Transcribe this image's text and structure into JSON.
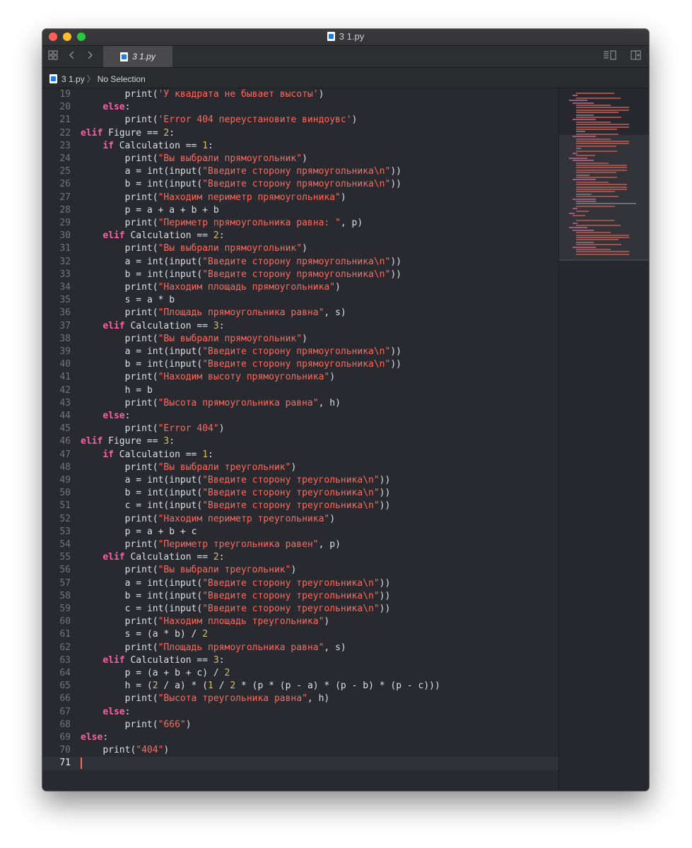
{
  "window": {
    "title": "3 1.py"
  },
  "tabs": [
    {
      "label": "3 1.py",
      "active": true
    }
  ],
  "jumpbar": {
    "file": "3 1.py",
    "selection": "No Selection"
  },
  "icons": {
    "grid": "related-items-grid-icon",
    "back": "chevron-left-icon",
    "forward": "chevron-right-icon",
    "editor_options": "editor-options-icon",
    "add_editor": "add-editor-icon"
  },
  "colors": {
    "background": "#292a30",
    "keyword": "#fc5fa3",
    "string": "#fc6a5d",
    "number": "#d0bf69",
    "text": "#dfdfe0",
    "line_number": "#747478"
  },
  "editor": {
    "current_line": 71,
    "lines": [
      {
        "n": 19,
        "code": "        print('У квадрата не бывает высоты')"
      },
      {
        "n": 20,
        "code": "    else:"
      },
      {
        "n": 21,
        "code": "        print('Error 404 переустановите виндоувс')"
      },
      {
        "n": 22,
        "code": "elif Figure == 2:"
      },
      {
        "n": 23,
        "code": "    if Calculation == 1:"
      },
      {
        "n": 24,
        "code": "        print(\"Вы выбрали прямоугольник\")"
      },
      {
        "n": 25,
        "code": "        a = int(input(\"Введите сторону прямоугольника\\n\"))"
      },
      {
        "n": 26,
        "code": "        b = int(input(\"Введите сторону прямоугольника\\n\"))"
      },
      {
        "n": 27,
        "code": "        print(\"Находим периметр прямоугольника\")"
      },
      {
        "n": 28,
        "code": "        p = a + a + b + b"
      },
      {
        "n": 29,
        "code": "        print(\"Периметр прямоугольника равна: \", p)"
      },
      {
        "n": 30,
        "code": "    elif Calculation == 2:"
      },
      {
        "n": 31,
        "code": "        print(\"Вы выбрали прямоугольник\")"
      },
      {
        "n": 32,
        "code": "        a = int(input(\"Введите сторону прямоугольника\\n\"))"
      },
      {
        "n": 33,
        "code": "        b = int(input(\"Введите сторону прямоугольника\\n\"))"
      },
      {
        "n": 34,
        "code": "        print(\"Находим площадь прямоугольника\")"
      },
      {
        "n": 35,
        "code": "        s = a * b"
      },
      {
        "n": 36,
        "code": "        print(\"Площадь прямоугольника равна\", s)"
      },
      {
        "n": 37,
        "code": "    elif Calculation == 3:"
      },
      {
        "n": 38,
        "code": "        print(\"Вы выбрали прямоугольник\")"
      },
      {
        "n": 39,
        "code": "        a = int(input(\"Введите сторону прямоугольника\\n\"))"
      },
      {
        "n": 40,
        "code": "        b = int(input(\"Введите сторону прямоугольника\\n\"))"
      },
      {
        "n": 41,
        "code": "        print(\"Находим высоту прямоугольника\")"
      },
      {
        "n": 42,
        "code": "        h = b"
      },
      {
        "n": 43,
        "code": "        print(\"Высота прямоугольника равна\", h)"
      },
      {
        "n": 44,
        "code": "    else:"
      },
      {
        "n": 45,
        "code": "        print(\"Error 404\")"
      },
      {
        "n": 46,
        "code": "elif Figure == 3:"
      },
      {
        "n": 47,
        "code": "    if Calculation == 1:"
      },
      {
        "n": 48,
        "code": "        print(\"Вы выбрали треугольник\")"
      },
      {
        "n": 49,
        "code": "        a = int(input(\"Введите сторону треугольника\\n\"))"
      },
      {
        "n": 50,
        "code": "        b = int(input(\"Введите сторону треугольника\\n\"))"
      },
      {
        "n": 51,
        "code": "        c = int(input(\"Введите сторону треугольника\\n\"))"
      },
      {
        "n": 52,
        "code": "        print(\"Находим периметр треугольника\")"
      },
      {
        "n": 53,
        "code": "        p = a + b + c"
      },
      {
        "n": 54,
        "code": "        print(\"Периметр треугольника равен\", p)"
      },
      {
        "n": 55,
        "code": "    elif Calculation == 2:"
      },
      {
        "n": 56,
        "code": "        print(\"Вы выбрали треугольник\")"
      },
      {
        "n": 57,
        "code": "        a = int(input(\"Введите сторону треугольника\\n\"))"
      },
      {
        "n": 58,
        "code": "        b = int(input(\"Введите сторону треугольника\\n\"))"
      },
      {
        "n": 59,
        "code": "        c = int(input(\"Введите сторону треугольника\\n\"))"
      },
      {
        "n": 60,
        "code": "        print(\"Находим площадь треугольника\")"
      },
      {
        "n": 61,
        "code": "        s = (a * b) / 2"
      },
      {
        "n": 62,
        "code": "        print(\"Площадь прямоугольника равна\", s)"
      },
      {
        "n": 63,
        "code": "    elif Calculation == 3:"
      },
      {
        "n": 64,
        "code": "        p = (a + b + c) / 2"
      },
      {
        "n": 65,
        "code": "        h = (2 / a) * (1 / 2 * (p * (p - a) * (p - b) * (p - c)))"
      },
      {
        "n": 66,
        "code": "        print(\"Высота треугольника равна\", h)"
      },
      {
        "n": 67,
        "code": "    else:"
      },
      {
        "n": 68,
        "code": "        print(\"666\")"
      },
      {
        "n": 69,
        "code": "else:"
      },
      {
        "n": 70,
        "code": "    print(\"404\")"
      },
      {
        "n": 71,
        "code": ""
      }
    ]
  }
}
